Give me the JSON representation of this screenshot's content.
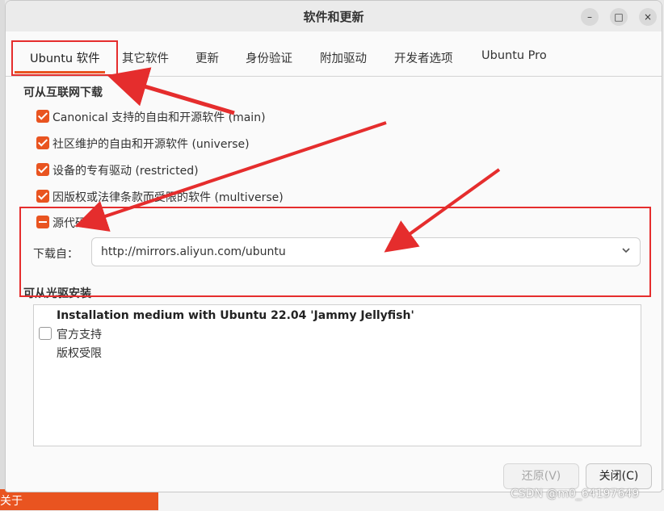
{
  "window": {
    "title": "软件和更新"
  },
  "window_buttons": {
    "minimize": "–",
    "maximize": "□",
    "close": "×"
  },
  "tabs": [
    {
      "label": "Ubuntu 软件",
      "active": true
    },
    {
      "label": "其它软件"
    },
    {
      "label": "更新"
    },
    {
      "label": "身份验证"
    },
    {
      "label": "附加驱动"
    },
    {
      "label": "开发者选项"
    },
    {
      "label": "Ubuntu Pro"
    }
  ],
  "internet": {
    "title": "可从互联网下载",
    "items": [
      {
        "label": "Canonical 支持的自由和开源软件 (main)",
        "state": "checked"
      },
      {
        "label": "社区维护的自由和开源软件 (universe)",
        "state": "checked"
      },
      {
        "label": "设备的专有驱动 (restricted)",
        "state": "checked"
      },
      {
        "label": "因版权或法律条款而受限的软件 (multiverse)",
        "state": "checked"
      },
      {
        "label": "源代码",
        "state": "mixed"
      }
    ],
    "download_from_label": "下载自：",
    "download_from_value": "http://mirrors.aliyun.com/ubuntu"
  },
  "cdrom": {
    "title": "可从光驱安装",
    "medium_name": "Installation medium with Ubuntu 22.04 'Jammy Jellyfish'",
    "line1": "官方支持",
    "line2": "版权受限",
    "checked": false
  },
  "buttons": {
    "revert": "还原(V)",
    "close": "关闭(C)"
  },
  "background": {
    "bottom_left_text": "关于"
  },
  "watermark": "CSDN @m0_64197649",
  "colors": {
    "accent": "#e95420",
    "annotation": "#e52d2d"
  }
}
